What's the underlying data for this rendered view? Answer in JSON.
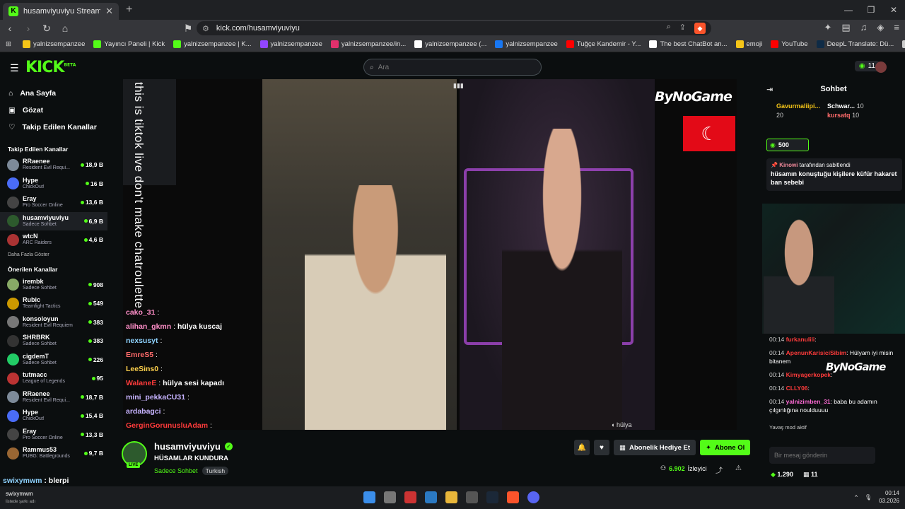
{
  "browser": {
    "tab_title": "husamviyuviyu Stream - Watch",
    "url": "kick.com/husamviyuviyu",
    "bookmarks": [
      {
        "label": "yalnizsempanzee",
        "color": "#f5c518"
      },
      {
        "label": "Yayıncı Paneli | Kick",
        "color": "#53fc18"
      },
      {
        "label": "yalnizsempanzee | K...",
        "color": "#53fc18"
      },
      {
        "label": "yalnizsempanzee",
        "color": "#9146ff"
      },
      {
        "label": "yalnizsempanzee/in...",
        "color": "#e1306c"
      },
      {
        "label": "yalnizsempanzee (...",
        "color": "#ffffff"
      },
      {
        "label": "yalnizsempanzee",
        "color": "#1877f2"
      },
      {
        "label": "Tuğçe Kandemir - Y...",
        "color": "#ff0000"
      },
      {
        "label": "The best ChatBot an...",
        "color": "#ffffff"
      },
      {
        "label": "emoji",
        "color": "#f5c518"
      },
      {
        "label": "YouTube",
        "color": "#ff0000"
      },
      {
        "label": "DeepL Translate: Dü...",
        "color": "#0f2b46"
      },
      {
        "label": "Canlı Yayın İçerikleri",
        "color": "#cccccc"
      }
    ]
  },
  "header": {
    "search_placeholder": "Ara",
    "points": "11"
  },
  "sidebar": {
    "nav": [
      {
        "icon": "⌂",
        "label": "Ana Sayfa"
      },
      {
        "icon": "▣",
        "label": "Gözat"
      },
      {
        "icon": "♡",
        "label": "Takip Edilen Kanallar"
      }
    ],
    "followed_title": "Takip Edilen Kanallar",
    "followed": [
      {
        "name": "RRaenee",
        "cat": "Resident Evil Requi...",
        "viewers": "18,9 B",
        "color": "#7d8a99"
      },
      {
        "name": "Hype",
        "cat": "ChickOut!",
        "viewers": "16 B",
        "color": "#4a6cf7"
      },
      {
        "name": "Eray",
        "cat": "Pro Soccer Online",
        "viewers": "13,6 B",
        "color": "#444"
      },
      {
        "name": "husamviyuviyu",
        "cat": "Sadece Sohbet",
        "viewers": "6,9 B",
        "color": "#2d5a2d"
      },
      {
        "name": "wtcN",
        "cat": "ARC Raiders",
        "viewers": "4,6 B",
        "color": "#a33"
      }
    ],
    "more": "Daha Fazla Göster",
    "suggested_title": "Önerilen Kanallar",
    "suggested": [
      {
        "name": "irembk",
        "cat": "Sadece Sohbet",
        "viewers": "908",
        "color": "#8a6"
      },
      {
        "name": "Rubic",
        "cat": "Teamfight Tactics",
        "viewers": "549",
        "color": "#c90"
      },
      {
        "name": "konsoloyun",
        "cat": "Resident Evil Requiem",
        "viewers": "383",
        "color": "#777"
      },
      {
        "name": "SHRBRK",
        "cat": "Sadece Sohbet",
        "viewers": "383",
        "color": "#333"
      },
      {
        "name": "cigdemT",
        "cat": "Sadece Sohbet",
        "viewers": "226",
        "color": "#2c6"
      },
      {
        "name": "tutmacc",
        "cat": "League of Legends",
        "viewers": "95",
        "color": "#b33"
      },
      {
        "name": "RRaenee",
        "cat": "Resident Evil Requi...",
        "viewers": "18,7 B",
        "color": "#7d8a99"
      },
      {
        "name": "Hype",
        "cat": "ChickOut!",
        "viewers": "15,4 B",
        "color": "#4a6cf7"
      },
      {
        "name": "Eray",
        "cat": "Pro Soccer Online",
        "viewers": "13,3 B",
        "color": "#444"
      },
      {
        "name": "Rammus53",
        "cat": "PUBG: Battlegrounds",
        "viewers": "9,7 B",
        "color": "#963"
      }
    ]
  },
  "player": {
    "vertical_text": "this is tiktok live don't make chatroulette",
    "brand": "ByNoGame",
    "guest_label": "hülya",
    "overlay_chat": [
      {
        "user": "cako_31",
        "color": "#ff8fc8",
        "text": ""
      },
      {
        "user": "alihan_gkmn",
        "color": "#ff8fc8",
        "text": "hülya kuscaj"
      },
      {
        "user": "nexsusyt",
        "color": "#8fd3ff",
        "text": ""
      },
      {
        "user": "EmreS5",
        "color": "#ff6b6b",
        "text": ""
      },
      {
        "user": "LeeSins0",
        "color": "#ffd24d",
        "text": ""
      },
      {
        "user": "WalaneE",
        "color": "#ff3b3b",
        "text": "hülya sesi kapadı"
      },
      {
        "user": "mini_pekkaCU31",
        "color": "#c7b3ff",
        "text": ""
      },
      {
        "user": "ardabagci",
        "color": "#c7b3ff",
        "text": ""
      },
      {
        "user": "GerginGorunusluAdam",
        "color": "#ff3b3b",
        "text": ""
      }
    ]
  },
  "stream": {
    "streamer": "husamviyuviyu",
    "title": "HÜSAMLAR KUNDURA",
    "category": "Sadece Sohbet",
    "tag": "Turkish",
    "live": "LIVE",
    "gift_label": "Abonelik Hediye Et",
    "sub_label": "Abone Ol",
    "viewers": "6.902",
    "viewers_label": "İzleyici"
  },
  "chat": {
    "title": "Sohbet",
    "leaders": [
      {
        "name": "Gavurmaliipi...",
        "count": "20"
      },
      {
        "name": "Schwar...",
        "count": "10"
      },
      {
        "name": "kursatq",
        "count": "10"
      }
    ],
    "gift_amount": "500",
    "pinned_by": "Kinowi",
    "pinned_suffix": "tarafından sabitlendi",
    "pinned_text": "hüsamın konuştuğu kişilere küfür hakaret ban sebebi",
    "messages": [
      {
        "ts": "00:14",
        "user": "furkanulili",
        "color": "#ff3b3b",
        "text": ""
      },
      {
        "ts": "00:14",
        "user": "ApenunKarisiciSibim",
        "color": "#ff3b3b",
        "text": "Hülyam iyi misin bitanem"
      },
      {
        "ts": "00:14",
        "user": "Kimyagerkopek",
        "color": "#ff3b3b",
        "text": ""
      },
      {
        "ts": "00:14",
        "user": "CLLY06",
        "color": "#ff3b3b",
        "text": ""
      },
      {
        "ts": "00:14",
        "user": "yalnizimben_31",
        "color": "#ff6bd6",
        "text": "baba bu adamın çılgınlığına noulduuuu"
      }
    ],
    "slow_mode": "Yavaş mod aktif",
    "input_placeholder": "Bir mesaj gönderin",
    "balance": "1.290",
    "badge_count": "11"
  },
  "bottom_chat": {
    "user": "swixymwm",
    "text": "blerpi"
  },
  "taskbar": {
    "user": "swixymwm",
    "sub": "listede şarkı adı",
    "time": "00:14",
    "date": "03.2026"
  }
}
